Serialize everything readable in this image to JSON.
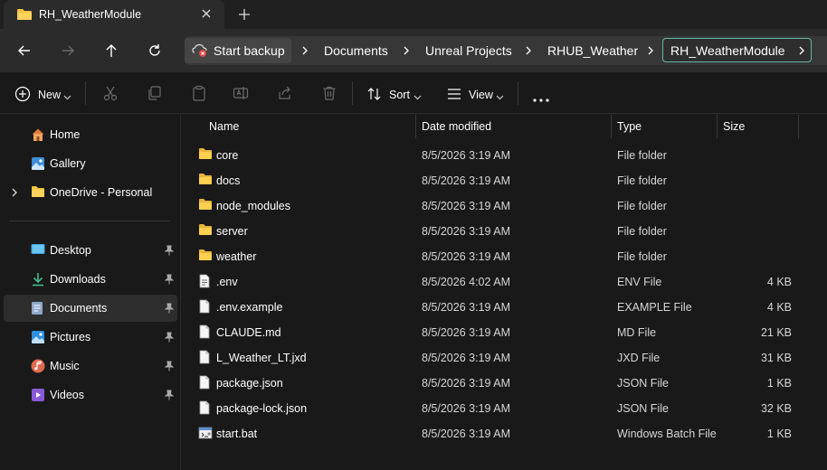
{
  "tab": {
    "title": "RH_WeatherModule"
  },
  "breadcrumb": {
    "start": "Start backup",
    "items": [
      "Documents",
      "Unreal Projects",
      "RHUB_Weather"
    ],
    "current": "RH_WeatherModule"
  },
  "commands": {
    "new": "New",
    "sort": "Sort",
    "view": "View"
  },
  "nav": {
    "items": [
      {
        "label": "Home",
        "icon": "home-icon"
      },
      {
        "label": "Gallery",
        "icon": "gallery-icon"
      },
      {
        "label": "OneDrive - Personal",
        "icon": "onedrive-folder-icon"
      },
      {
        "label": "Desktop",
        "icon": "desktop-icon"
      },
      {
        "label": "Downloads",
        "icon": "downloads-icon"
      },
      {
        "label": "Documents",
        "icon": "documents-icon"
      },
      {
        "label": "Pictures",
        "icon": "pictures-icon"
      },
      {
        "label": "Music",
        "icon": "music-icon"
      },
      {
        "label": "Videos",
        "icon": "videos-icon"
      }
    ]
  },
  "columns": {
    "name": "Name",
    "date": "Date modified",
    "type": "Type",
    "size": "Size"
  },
  "files": [
    {
      "name": "core",
      "date": "8/5/2026 3:19 AM",
      "type": "File folder",
      "size": "",
      "kind": "folder"
    },
    {
      "name": "docs",
      "date": "8/5/2026 3:19 AM",
      "type": "File folder",
      "size": "",
      "kind": "folder"
    },
    {
      "name": "node_modules",
      "date": "8/5/2026 3:19 AM",
      "type": "File folder",
      "size": "",
      "kind": "folder"
    },
    {
      "name": "server",
      "date": "8/5/2026 3:19 AM",
      "type": "File folder",
      "size": "",
      "kind": "folder"
    },
    {
      "name": "weather",
      "date": "8/5/2026 3:19 AM",
      "type": "File folder",
      "size": "",
      "kind": "folder"
    },
    {
      "name": ".env",
      "date": "8/5/2026 4:02 AM",
      "type": "ENV File",
      "size": "4 KB",
      "kind": "config"
    },
    {
      "name": ".env.example",
      "date": "8/5/2026 3:19 AM",
      "type": "EXAMPLE File",
      "size": "4 KB",
      "kind": "file"
    },
    {
      "name": "CLAUDE.md",
      "date": "8/5/2026 3:19 AM",
      "type": "MD File",
      "size": "21 KB",
      "kind": "file"
    },
    {
      "name": "L_Weather_LT.jxd",
      "date": "8/5/2026 3:19 AM",
      "type": "JXD File",
      "size": "31 KB",
      "kind": "file"
    },
    {
      "name": "package.json",
      "date": "8/5/2026 3:19 AM",
      "type": "JSON File",
      "size": "1 KB",
      "kind": "file"
    },
    {
      "name": "package-lock.json",
      "date": "8/5/2026 3:19 AM",
      "type": "JSON File",
      "size": "32 KB",
      "kind": "file"
    },
    {
      "name": "start.bat",
      "date": "8/5/2026 3:19 AM",
      "type": "Windows Batch File",
      "size": "1 KB",
      "kind": "batch"
    }
  ],
  "colors": {
    "folder": "#f4c542",
    "accent": "#61b8a9",
    "background": "#191919"
  }
}
